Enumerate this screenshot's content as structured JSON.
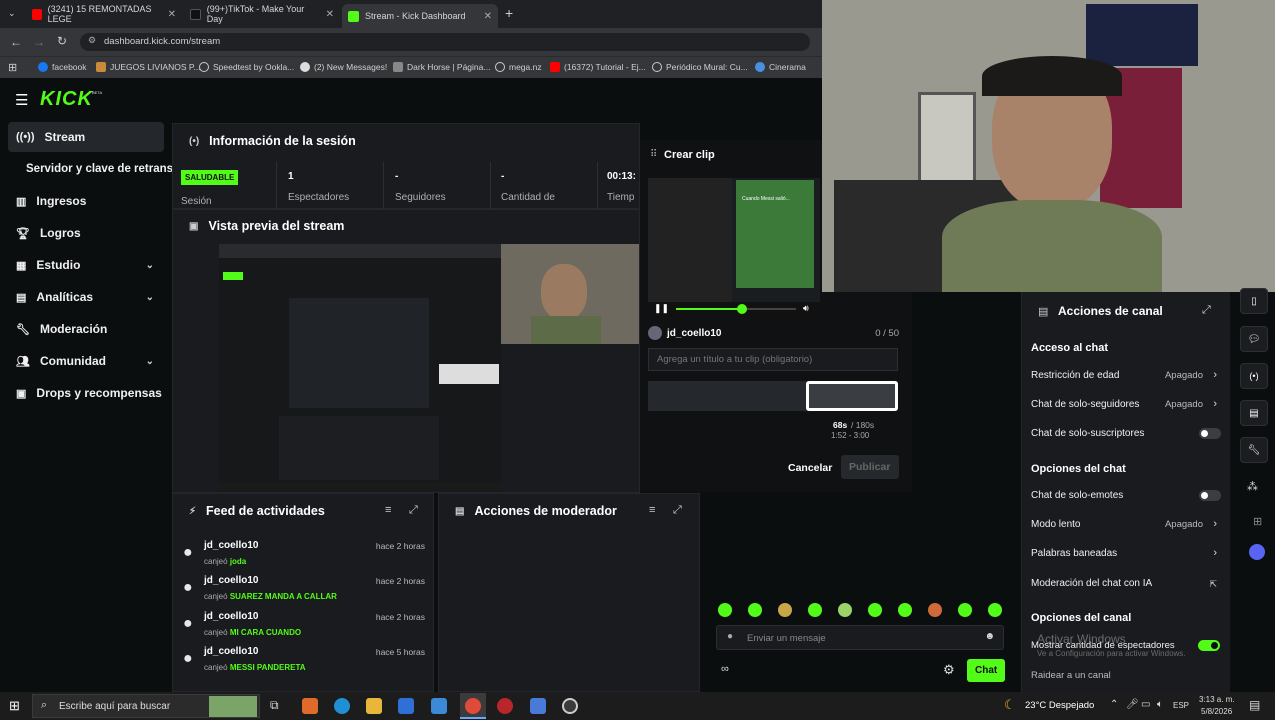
{
  "browser": {
    "tabs": [
      {
        "label": "(3241) 15 REMONTADAS LEGE",
        "color": "#ff0000"
      },
      {
        "label": "(99+)TikTok - Make Your Day",
        "color": "#111111"
      },
      {
        "label": "Stream - Kick Dashboard",
        "color": "#53fc18",
        "active": true
      }
    ],
    "url": "dashboard.kick.com/stream",
    "bookmarks": [
      "facebook",
      "JUEGOS LIVIANOS P...",
      "Speedtest by Ookla...",
      "(2) New Messages!",
      "Dark Horse | Página...",
      "mega.nz",
      "(16372) Tutorial - Ej...",
      "Periódico Mural: Cu...",
      "Cinerama"
    ]
  },
  "kick": {
    "logo": "KICK",
    "logo_badge": "BETA",
    "sidebar": [
      {
        "label": "Stream",
        "icon": "broadcast-icon",
        "selected": true
      },
      {
        "label": "Servidor y clave de retransm",
        "icon": "",
        "sub": true
      },
      {
        "label": "Ingresos",
        "icon": "bar-chart-icon"
      },
      {
        "label": "Logros",
        "icon": "trophy-icon"
      },
      {
        "label": "Estudio",
        "icon": "grid-icon",
        "chevron": true
      },
      {
        "label": "Analíticas",
        "icon": "analytics-icon",
        "chevron": true
      },
      {
        "label": "Moderación",
        "icon": "wrench-icon"
      },
      {
        "label": "Comunidad",
        "icon": "people-icon",
        "chevron": true
      },
      {
        "label": "Drops y recompensas",
        "icon": "gift-icon"
      }
    ],
    "session": {
      "title": "Información de la sesión",
      "badge": "SALUDABLE",
      "badge_label": "Sesión",
      "stats": [
        {
          "value": "1",
          "label": "Espectadores"
        },
        {
          "value": "-",
          "label": "Seguidores"
        },
        {
          "value": "-",
          "label": "Cantidad de"
        },
        {
          "value": "00:13:",
          "label": "Tiemp"
        }
      ]
    },
    "preview": {
      "title": "Vista previa del stream"
    },
    "feed": {
      "title": "Feed de actividades",
      "items": [
        {
          "user": "jd_coello10",
          "time": "hace 2 horas",
          "action": "canjeó",
          "reward": "joda"
        },
        {
          "user": "jd_coello10",
          "time": "hace 2 horas",
          "action": "canjeó",
          "reward": "SUAREZ MANDA A CALLAR"
        },
        {
          "user": "jd_coello10",
          "time": "hace 2 horas",
          "action": "canjeó",
          "reward": "MI CARA CUANDO"
        },
        {
          "user": "jd_coello10",
          "time": "hace 5 horas",
          "action": "canjeó",
          "reward": "MESSI PANDERETA"
        }
      ]
    },
    "mod": {
      "title": "Acciones de moderador"
    },
    "clip": {
      "title": "Crear clip",
      "user": "jd_coello10",
      "count": "0 / 50",
      "placeholder": "Agrega un título a tu clip (obligatorio)",
      "duration": "68s",
      "duration_max": "/ 180s",
      "range": "1:52 - 3:00",
      "cancel": "Cancelar",
      "publish": "Publicar",
      "progress": 0.55
    },
    "channel_actions": {
      "title": "Acciones de canal",
      "chat_access": "Acceso al chat",
      "age": {
        "label": "Restricción de edad",
        "value": "Apagado"
      },
      "followers": {
        "label": "Chat de solo-seguidores",
        "value": "Apagado"
      },
      "subs": {
        "label": "Chat de solo-suscriptores",
        "on": false
      },
      "chat_options": "Opciones del chat",
      "emotes": {
        "label": "Chat de solo-emotes",
        "on": false
      },
      "slow": {
        "label": "Modo lento",
        "value": "Apagado"
      },
      "banned": {
        "label": "Palabras baneadas"
      },
      "ai": {
        "label": "Moderación del chat con IA"
      },
      "channel_options": "Opciones del canal",
      "viewers": {
        "label": "Mostrar cantidad de espectadores",
        "on": true
      },
      "raid": "Raidear a un canal"
    },
    "chat": {
      "placeholder": "Enviar un mensaje",
      "button": "Chat"
    },
    "watermark": {
      "line1": "Activar Windows",
      "line2": "Ve a Configuración para activar Windows."
    }
  },
  "taskbar": {
    "search": "Escribe aquí para buscar",
    "weather": "23°C  Despejado",
    "lang": "ESP",
    "time": "3:13 a. m.",
    "date": "5/8/2026"
  }
}
